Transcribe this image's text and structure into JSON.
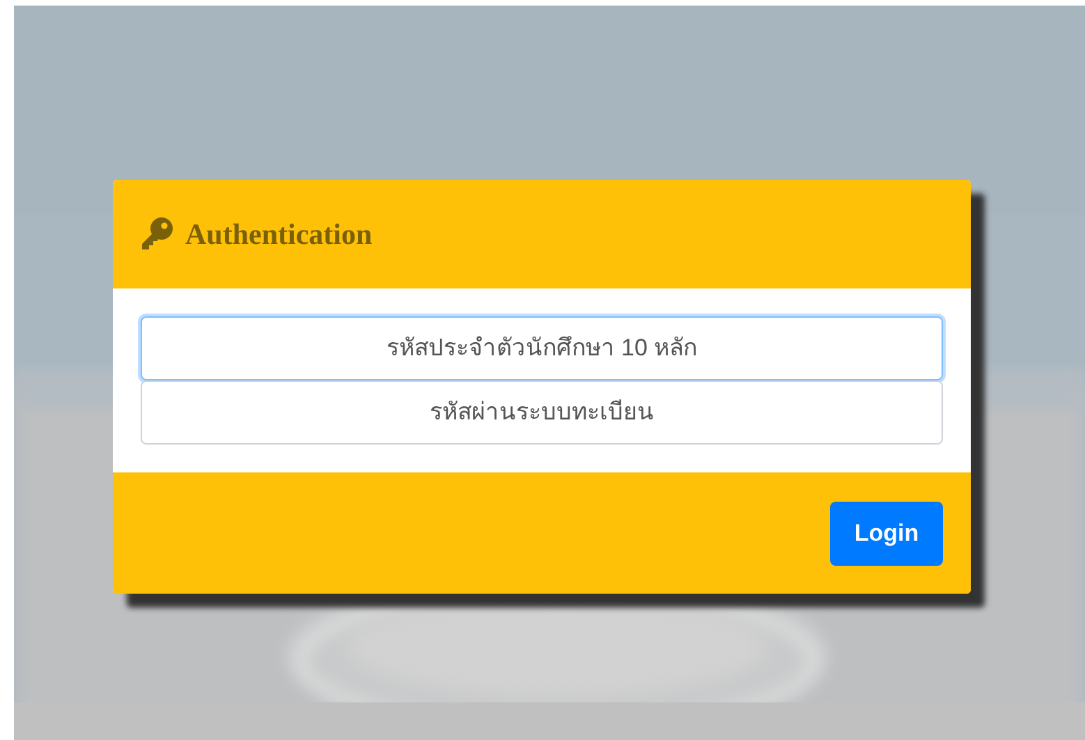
{
  "dialog": {
    "title": "Authentication",
    "fields": [
      {
        "placeholder": "รหัสประจำตัวนักศึกษา 10 หลัก",
        "focused": true
      },
      {
        "placeholder": "รหัสผ่านระบบทะเบียน",
        "focused": false
      }
    ],
    "buttons": [
      "Login"
    ]
  }
}
